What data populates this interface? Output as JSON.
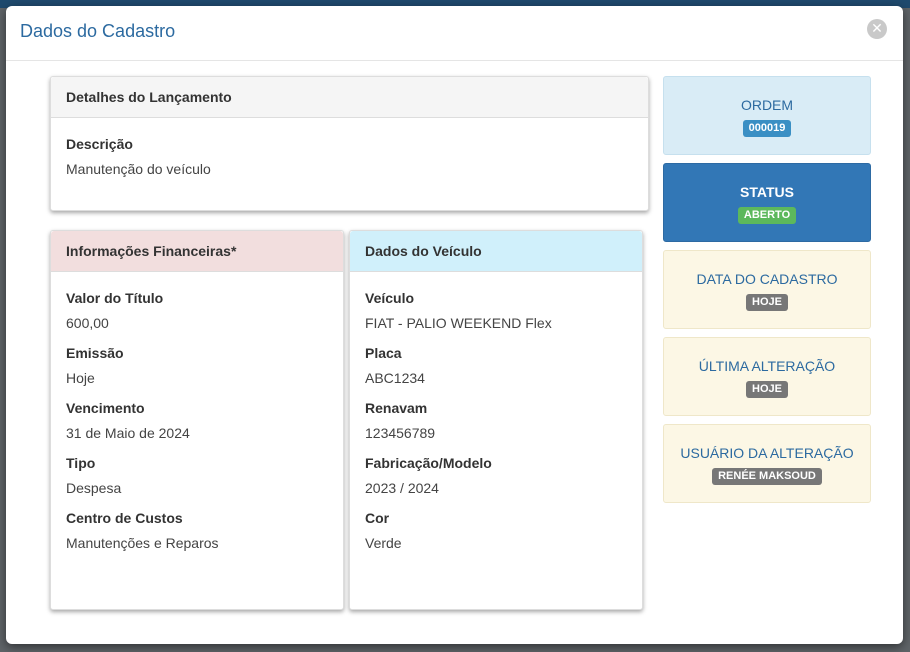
{
  "modal": {
    "title": "Dados do Cadastro",
    "close_glyph": "✕"
  },
  "lancamento": {
    "heading": "Detalhes do Lançamento",
    "descricao_label": "Descrição",
    "descricao_value": "Manutenção do veículo"
  },
  "financeiras": {
    "heading": "Informações Financeiras*",
    "fields": [
      {
        "label": "Valor do Título",
        "value": "600,00"
      },
      {
        "label": "Emissão",
        "value": "Hoje"
      },
      {
        "label": "Vencimento",
        "value": "31 de Maio de 2024"
      },
      {
        "label": "Tipo",
        "value": "Despesa"
      },
      {
        "label": "Centro de Custos",
        "value": "Manutenções e Reparos"
      }
    ]
  },
  "veiculo": {
    "heading": "Dados do Veículo",
    "fields": [
      {
        "label": "Veículo",
        "value": "FIAT - PALIO WEEKEND Flex"
      },
      {
        "label": "Placa",
        "value": "ABC1234"
      },
      {
        "label": "Renavam",
        "value": "123456789"
      },
      {
        "label": "Fabricação/Modelo",
        "value": "2023 / 2024"
      },
      {
        "label": "Cor",
        "value": "Verde"
      }
    ]
  },
  "info": [
    {
      "title": "ORDEM",
      "badge": "000019",
      "badge_color": "#3a8fc4"
    },
    {
      "title": "STATUS",
      "badge": "ABERTO",
      "badge_color": "#5cb85c"
    },
    {
      "title": "DATA DO CADASTRO",
      "badge": "HOJE",
      "badge_color": "#777777"
    },
    {
      "title": "ÚLTIMA ALTERAÇÃO",
      "badge": "HOJE",
      "badge_color": "#777777"
    },
    {
      "title": "USUÁRIO DA ALTERAÇÃO",
      "badge": "RENÉE MAKSOUD",
      "badge_color": "#777777"
    }
  ],
  "colors": {
    "accent": "#2c6aa0",
    "status_box": "#3277b6"
  }
}
